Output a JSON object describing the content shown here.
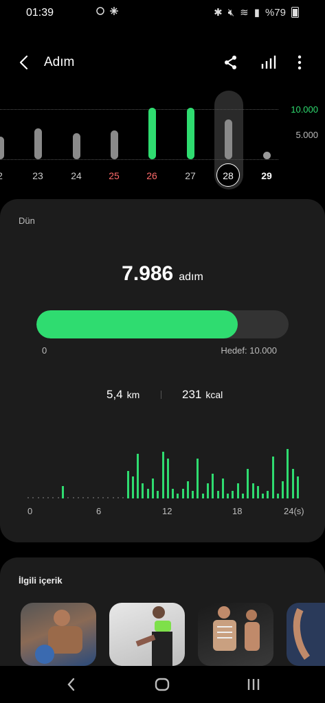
{
  "status": {
    "time": "01:39",
    "battery": "%79"
  },
  "header": {
    "title": "Adım"
  },
  "week": {
    "y_labels": [
      "10.000",
      "5.000"
    ],
    "days": [
      {
        "label": "2",
        "value": 4500,
        "goal_met": false,
        "red": false
      },
      {
        "label": "23",
        "value": 6100,
        "goal_met": false,
        "red": false
      },
      {
        "label": "24",
        "value": 5200,
        "goal_met": false,
        "red": false
      },
      {
        "label": "25",
        "value": 5800,
        "goal_met": false,
        "red": true
      },
      {
        "label": "26",
        "value": 10300,
        "goal_met": true,
        "red": true
      },
      {
        "label": "27",
        "value": 10300,
        "goal_met": true,
        "red": false
      },
      {
        "label": "28",
        "value": 7986,
        "goal_met": false,
        "red": false,
        "selected": true
      },
      {
        "label": "29",
        "value": 0,
        "goal_met": false,
        "red": false,
        "today": true
      }
    ]
  },
  "summary": {
    "period_label": "Dün",
    "steps": "7.986",
    "steps_unit": "adım",
    "progress_fraction": 0.7986,
    "progress_min": "0",
    "goal_label": "Hedef: 10.000",
    "distance": "5,4",
    "distance_unit": "km",
    "calories": "231",
    "calories_unit": "kcal"
  },
  "hourly": {
    "x_labels": [
      "0",
      "6",
      "12",
      "18",
      "24(s)"
    ],
    "values": [
      0,
      0,
      0,
      0,
      0,
      0,
      0,
      0.25,
      0,
      0,
      0,
      0,
      0,
      0,
      0,
      0,
      0,
      0,
      0,
      0,
      0.55,
      0.45,
      0.9,
      0.3,
      0.2,
      0.4,
      0.15,
      0.95,
      0.8,
      0.2,
      0.1,
      0.2,
      0.35,
      0.15,
      0.8,
      0.1,
      0.3,
      0.5,
      0.15,
      0.4,
      0.1,
      0.15,
      0.3,
      0.1,
      0.6,
      0.3,
      0.25,
      0.1,
      0.15,
      0.85,
      0.1,
      0.35,
      1.0,
      0.6,
      0.45
    ]
  },
  "related": {
    "title": "İlgili içerik"
  },
  "colors": {
    "accent": "#2fdc70",
    "red_day": "#ff6b6b",
    "card": "#1c1c1c"
  },
  "icons": {
    "back": "chevron-left-icon",
    "share": "share-icon",
    "chart": "bar-chart-icon",
    "more": "more-vertical-icon"
  }
}
